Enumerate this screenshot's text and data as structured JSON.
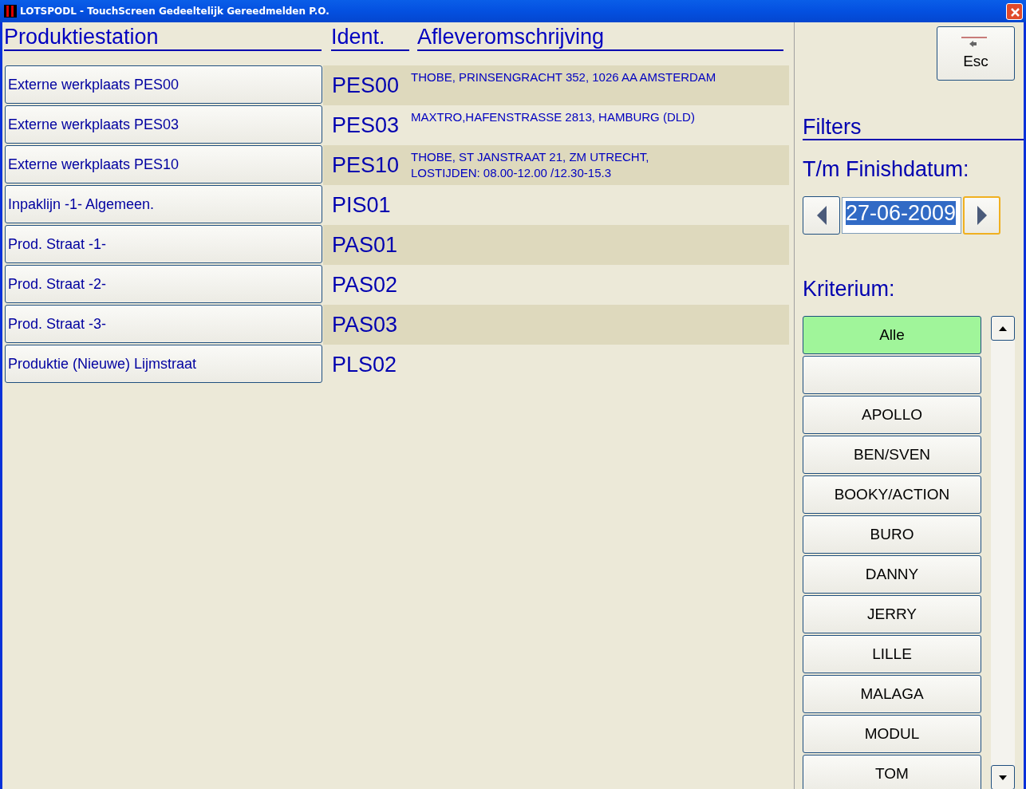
{
  "window": {
    "title": "LOTSPODL - TouchScreen Gedeeltelijk Gereedmelden P.O."
  },
  "columns": [
    "Produktiestation",
    "Ident.",
    "Afleveromschrijving"
  ],
  "rows": [
    {
      "station": "Externe werkplaats PES00",
      "ident": "PES00",
      "address": [
        "THOBE, PRINSENGRACHT 352, 1026 AA AMSTERDAM"
      ]
    },
    {
      "station": "Externe werkplaats PES03",
      "ident": "PES03",
      "address": [
        "MAXTRO,HAFENSTRASSE 2813, HAMBURG (DLD)"
      ]
    },
    {
      "station": "Externe werkplaats PES10",
      "ident": "PES10",
      "address": [
        "THOBE,  ST JANSTRAAT 21,  ZM UTRECHT,",
        "LOSTIJDEN: 08.00-12.00 /12.30-15.3"
      ]
    },
    {
      "station": "Inpaklijn -1- Algemeen.",
      "ident": "PIS01",
      "address": []
    },
    {
      "station": "Prod. Straat -1-",
      "ident": "PAS01",
      "address": []
    },
    {
      "station": "Prod. Straat -2-",
      "ident": "PAS02",
      "address": []
    },
    {
      "station": "Prod. Straat -3-",
      "ident": "PAS03",
      "address": []
    },
    {
      "station": "Produktie (Nieuwe) Lijmstraat",
      "ident": "PLS02",
      "address": []
    }
  ],
  "esc_button": {
    "label": "Esc"
  },
  "filters": {
    "title": "Filters",
    "date_label": "T/m Finishdatum:",
    "date_value": "27-06-2009",
    "next_focused": true,
    "criterium_label": "Kriterium:",
    "criteria": [
      {
        "label": "Alle",
        "selected": true
      },
      {
        "selected": false
      },
      {
        "label": "APOLLO",
        "selected": false
      },
      {
        "label": "BEN/SVEN",
        "selected": false
      },
      {
        "label": "BOOKY/ACTION",
        "selected": false
      },
      {
        "label": "BURO",
        "selected": false
      },
      {
        "label": "DANNY",
        "selected": false
      },
      {
        "label": "JERRY",
        "selected": false
      },
      {
        "label": "LILLE",
        "selected": false
      },
      {
        "label": "MALAGA",
        "selected": false
      },
      {
        "label": "MODUL",
        "selected": false
      },
      {
        "label": "TOM",
        "selected": false
      }
    ]
  }
}
